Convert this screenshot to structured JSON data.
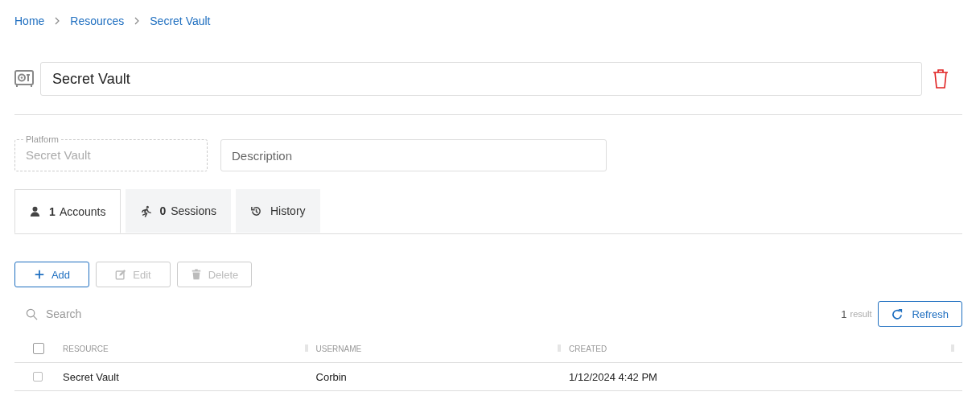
{
  "breadcrumb": [
    {
      "label": "Home"
    },
    {
      "label": "Resources"
    },
    {
      "label": "Secret Vault"
    }
  ],
  "name_field": {
    "value": "Secret Vault"
  },
  "platform_field": {
    "label": "Platform",
    "value": "Secret Vault",
    "disabled": true
  },
  "description_field": {
    "placeholder": "Description"
  },
  "tabs": [
    {
      "kind": "user",
      "label": "**1** Accounts",
      "selected": true
    },
    {
      "kind": "run",
      "label": "**0** Sessions",
      "selected": false
    },
    {
      "kind": "history",
      "label": "History",
      "selected": false
    }
  ],
  "toolbar": [
    {
      "kind": "plus",
      "label": "Add",
      "disabled": false
    },
    {
      "kind": "edit",
      "label": "Edit",
      "disabled": true
    },
    {
      "kind": "trash",
      "label": "Delete",
      "disabled": true
    }
  ],
  "search": {
    "placeholder": "Search"
  },
  "result_count": {
    "count": "1",
    "label": "result"
  },
  "refresh_button": {
    "label": "Refresh"
  },
  "table": {
    "select_all_checked": false,
    "columns": [
      "RESOURCE",
      "USERNAME",
      "CREATED"
    ],
    "rows": [
      {
        "checked": false,
        "cells": [
          "Secret Vault",
          "Corbin",
          "1/12/2024 4:42 PM"
        ]
      }
    ]
  }
}
